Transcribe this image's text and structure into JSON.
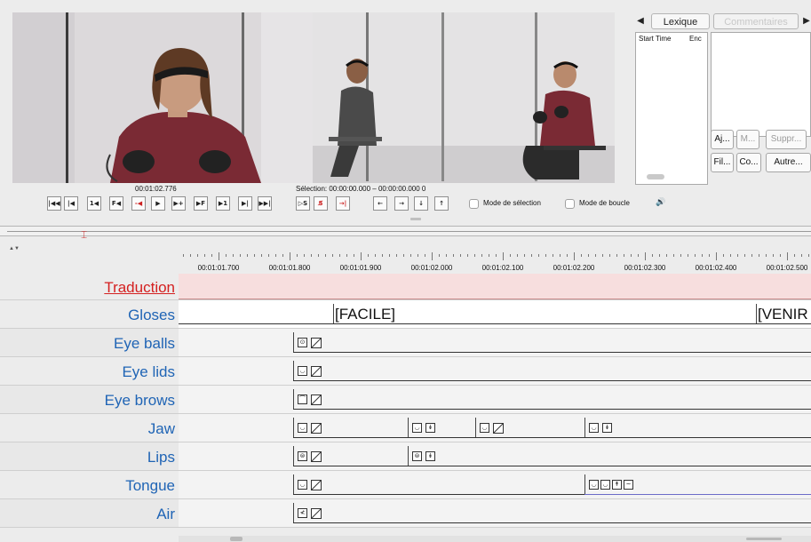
{
  "player": {
    "current_time": "00:01:02.776",
    "selection": "Sélection: 00:00:00.000 – 00:00:00.000  0",
    "controls": [
      "|◀◀",
      "|◀",
      "1◀",
      "F◀",
      "-◀",
      "▶",
      "▶+",
      "▶F",
      "▶1",
      "▶|",
      "▶▶|"
    ],
    "nav_controls": [
      "▷S",
      "S̸",
      "→|",
      "←",
      "→",
      "↓",
      "↑"
    ],
    "selection_mode_label": "Mode de sélection",
    "loop_mode_label": "Mode de boucle",
    "volume_icon": "speaker-icon"
  },
  "side_panel": {
    "tab_prev": "◀",
    "tab_lexique": "Lexique",
    "tab_commentaires": "Commentaires",
    "tab_next": "▶",
    "col_start": "Start Time",
    "col_end": "Enc",
    "btn_aj": "Aj...",
    "btn_m": "M...",
    "btn_suppr": "Suppr...",
    "btn_fil": "Fil...",
    "btn_co": "Co...",
    "btn_autre": "Autre..."
  },
  "ruler": {
    "labels": [
      "00:01:01.700",
      "00:01:01.800",
      "00:01:01.900",
      "00:01:02.000",
      "00:01:02.100",
      "00:01:02.200",
      "00:01:02.300",
      "00:01:02.400",
      "00:01:02.500"
    ]
  },
  "tiers": [
    {
      "name": "Traduction",
      "style": "red"
    },
    {
      "name": "Gloses"
    },
    {
      "name": "Eye balls"
    },
    {
      "name": "Eye lids"
    },
    {
      "name": "Eye brows"
    },
    {
      "name": "Jaw"
    },
    {
      "name": "Lips"
    },
    {
      "name": "Tongue"
    },
    {
      "name": "Air"
    }
  ],
  "gloses": {
    "gloss_1": "[FACILE]",
    "gloss_2": "[VENIR"
  },
  "colors": {
    "tier_label": "#1f64b5",
    "tier_label_active": "#d42020",
    "traduction_bg": "#f7dede"
  }
}
